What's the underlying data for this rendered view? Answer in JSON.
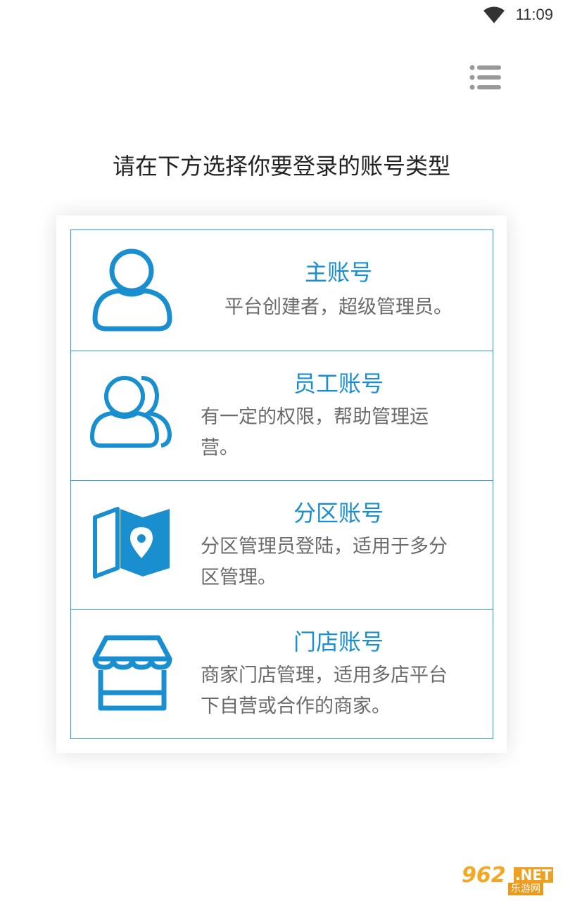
{
  "status_bar": {
    "time": "11:09",
    "wifi_icon": "wifi-icon"
  },
  "header": {
    "menu_icon": "list-menu-icon"
  },
  "page": {
    "title": "请在下方选择你要登录的账号类型"
  },
  "colors": {
    "accent": "#1a8fd0",
    "border": "#2f98d3",
    "description": "#6b6b6b"
  },
  "accounts": [
    {
      "icon": "user-icon",
      "title": "主账号",
      "description": "平台创建者，超级管理员。"
    },
    {
      "icon": "users-icon",
      "title": "员工账号",
      "description_line1": "有一定的权限，帮助管理运",
      "description_line2": "营。"
    },
    {
      "icon": "map-pin-icon",
      "title": "分区账号",
      "description_line1": "分区管理员登陆，适用于多分",
      "description_line2": "区管理。"
    },
    {
      "icon": "store-icon",
      "title": "门店账号",
      "description_line1": "商家门店管理，适用多店平台",
      "description_line2": "下自营或合作的商家。"
    }
  ],
  "watermark": {
    "brand": "962",
    "suffix": ".NET",
    "subtitle": "乐游网"
  }
}
